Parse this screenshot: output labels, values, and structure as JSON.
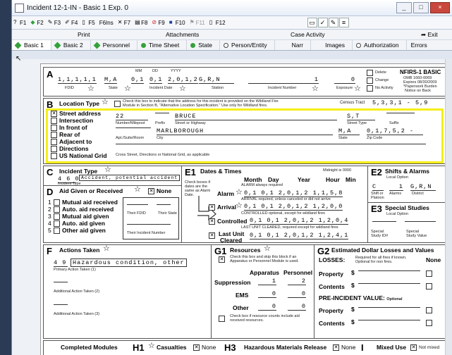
{
  "window": {
    "title": "Incident 12-1-IN - Basic 1 Exp. 0",
    "min": "_",
    "max": "□",
    "close": "×"
  },
  "fkeys": [
    "F1",
    "F2",
    "F3",
    "F4",
    "F5",
    "F6Ins",
    "F7",
    "F8",
    "F9",
    "F10",
    "F11",
    "F12"
  ],
  "tabs_top": {
    "print": "Print",
    "attachments": "Attachments",
    "case_activity": "Case Activity",
    "exit": "Exit"
  },
  "tabs": {
    "basic1": "Basic 1",
    "basic2": "Basic 2",
    "personnel": "Personnel",
    "timesheet": "Time Sheet",
    "state": "State",
    "person_entity": "Person/Entity",
    "narr": "Narr",
    "images": "Images",
    "authorization": "Authorization",
    "errors": "Errors"
  },
  "A": {
    "letter": "A",
    "fdid": "1,1,1,1,1",
    "state": "M,A",
    "mm": "0,1",
    "dd": "0,1",
    "yyyy": "2,0,1,2",
    "station": "G,R,N",
    "incident_number": "1",
    "exposure": "0",
    "mm_lbl": "MM",
    "dd_lbl": "DD",
    "yyyy_lbl": "YYYY",
    "fdid_lbl": "FDID",
    "state_lbl": "State",
    "date_lbl": "Incident Date",
    "station_lbl": "Station",
    "num_lbl": "Incident Number",
    "exp_lbl": "Exposure",
    "delete": "Delete",
    "change": "Change",
    "no_activity": "No Activity",
    "nfirs": "NFIRS-1 BASIC",
    "omb1": "OMB 1660-0069",
    "omb2": "Expires 08/30/2009",
    "omb3": "*Paperwork Burden",
    "omb4": "Notice on Back"
  },
  "B": {
    "letter": "B",
    "title": "Location Type",
    "note1": "Check this box to indicate that the address for this incident is provided on the Wildland Fire",
    "note2": "Module in Section B, \"Alternative Location Specification.\" Use only for Wildland fires.",
    "census_lbl": "Census Tract",
    "census": "5,3,3,1 - 5,9",
    "options": [
      "Street address",
      "Intersection",
      "In front of",
      "Rear of",
      "Adjacent to",
      "Directions",
      "US National Grid"
    ],
    "number": "22",
    "street": "BRUCE",
    "street_type": "S,T",
    "city": "MARLBOROUGH",
    "state": "M,A",
    "zip": "0,1,7,5,2 -",
    "number_lbl": "Number/Milepost",
    "prefix_lbl": "Prefix",
    "street_lbl": "Street or Highway",
    "type_lbl": "Street Type",
    "suffix_lbl": "Suffix",
    "apt_lbl": "Apt./Suite/Room",
    "city_lbl": "City",
    "state_lbl": "State",
    "zip_lbl": "Zip Code",
    "cross_lbl": "Cross Street, Directions or National Grid, as applicable"
  },
  "C": {
    "letter": "C",
    "title": "Incident Type",
    "code": "4 6 0",
    "desc": "Accident, potential accident",
    "lbl": "Incident Type"
  },
  "D": {
    "letter": "D",
    "title": "Aid Given or Received",
    "none": "None",
    "items": [
      "Mutual aid received",
      "Auto. aid received",
      "Mutual aid given",
      "Auto. aid given",
      "Other aid given"
    ],
    "nums": [
      "1",
      "2",
      "3",
      "4",
      "5"
    ],
    "fdid_lbl": "Their FDID",
    "state_lbl": "Their State",
    "inc_lbl": "Their Incident Number"
  },
  "E1": {
    "letter": "E1",
    "title": "Dates & Times",
    "midnight": "Midnight is 0000",
    "month": "Month",
    "day": "Day",
    "year": "Year",
    "hour": "Hour",
    "min": "Min",
    "note1": "Check boxes if",
    "note2": "dates are the",
    "note3": "same as Alarm",
    "note4": "Date.",
    "alarm": "Alarm",
    "alarm_note": "ALARM always required",
    "alarm_val": "0,1  0,1  2,0,1,2  1,1,5,8",
    "arrival": "Arrival",
    "arrival_note": "ARRIVAL required, unless canceled or did not arrive",
    "arrival_val": "0,1  0,1  2,0,1,2  1,2,0,0",
    "controlled": "Controlled",
    "controlled_note": "CONTROLLED optional, except for wildland fires",
    "controlled_val": "0,1  0,1  2,0,1,2  1,2,0,4",
    "last": "Last Unit",
    "cleared": "Cleared",
    "last_note": "LAST UNIT CLEARED, required except for wildland fires",
    "last_val": "0,1  0,1  2,0,1,2  1,2,4,1"
  },
  "E2": {
    "letter": "E2",
    "title": "Shifts & Alarms",
    "local": "Local Option",
    "shift": "C",
    "alarms": "1",
    "district": "G,R,N",
    "shift_lbl": "Shift or Platoon",
    "alarms_lbl": "Alarms",
    "district_lbl": "District"
  },
  "E3": {
    "letter": "E3",
    "title": "Special Studies",
    "local": "Local Option",
    "id_lbl": "Special Study ID#",
    "val_lbl": "Special Study Value"
  },
  "F": {
    "letter": "F",
    "title": "Actions Taken",
    "code": "4 9",
    "desc": "Hazardous condition, other",
    "p": "Primary Action Taken (1)",
    "a2": "Additional Action Taken (2)",
    "a3": "Additional Action Taken (3)"
  },
  "G1": {
    "letter": "G1",
    "title": "Resources",
    "note1": "Check this box and skip this block if an",
    "note2": "Apparatus or Personnel Module is used.",
    "apparatus": "Apparatus",
    "personnel": "Personnel",
    "suppression": "Suppression",
    "sup_a": "1",
    "sup_p": "2",
    "ems": "EMS",
    "ems_a": "0",
    "ems_p": "0",
    "other": "Other",
    "oth_a": "0",
    "oth_p": "0",
    "foot1": "Check box if resource counts include aid",
    "foot2": "received resources."
  },
  "G2": {
    "letter": "G2",
    "title": "Estimated Dollar Losses and Values",
    "losses": "LOSSES:",
    "req1": "Required for all fires if known.",
    "req2": "Optional for non fires.",
    "none": "None",
    "property": "Property",
    "contents": "Contents",
    "pre": "PRE-INCIDENT VALUE:",
    "optional": "Optional",
    "dollar": "$"
  },
  "bottom": {
    "completed": "Completed Modules",
    "h1": "H1",
    "casualties": "Casualties",
    "none1": "None",
    "h3": "H3",
    "hazmat": "Hazardous Materials Release",
    "none2": "None",
    "i": "I",
    "mixed": "Mixed Use",
    "not_mixed": "Not mixed"
  }
}
